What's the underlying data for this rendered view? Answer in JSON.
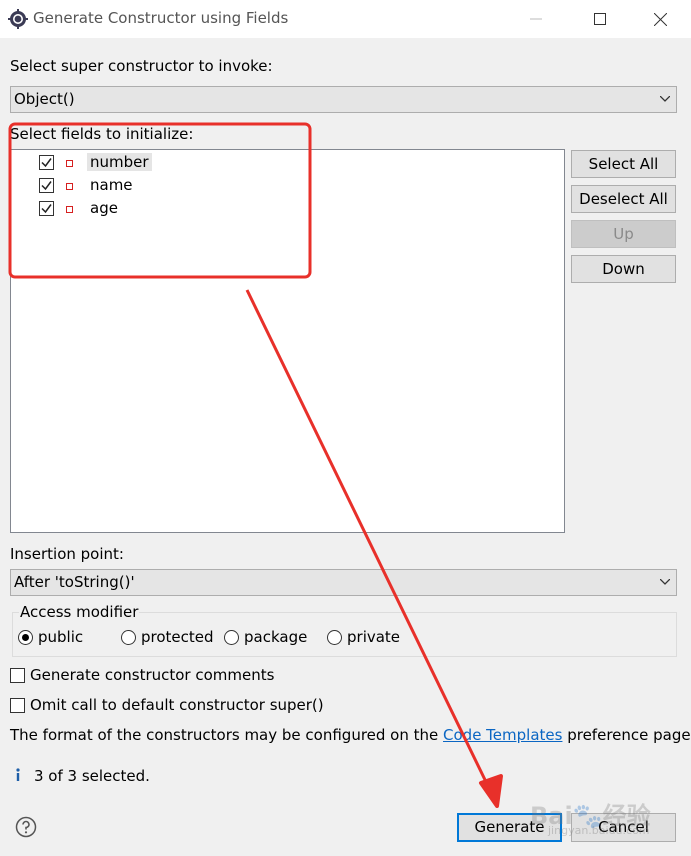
{
  "window": {
    "title": "Generate Constructor using Fields",
    "app_icon": "eclipse-gear-icon",
    "controls": [
      "minimize-icon",
      "maximize-icon",
      "close-icon"
    ]
  },
  "super_constructor": {
    "label": "Select super constructor to invoke:",
    "value": "Object()"
  },
  "fields": {
    "label": "Select fields to initialize:",
    "items": [
      {
        "name": "number",
        "checked": true,
        "selected": true
      },
      {
        "name": "name",
        "checked": true,
        "selected": false
      },
      {
        "name": "age",
        "checked": true,
        "selected": false
      }
    ]
  },
  "side_buttons": {
    "select_all": "Select All",
    "deselect_all": "Deselect All",
    "up": "Up",
    "down": "Down"
  },
  "insertion_point": {
    "label": "Insertion point:",
    "value": "After 'toString()'"
  },
  "access_modifier": {
    "title": "Access modifier",
    "options": [
      "public",
      "protected",
      "package",
      "private"
    ],
    "selected": "public"
  },
  "options": {
    "generate_comments": {
      "label": "Generate constructor comments",
      "checked": false
    },
    "omit_super": {
      "label": "Omit call to default constructor super()",
      "checked": false
    }
  },
  "info": {
    "text_before": "The format of the constructors may be configured on the ",
    "link": "Code Templates",
    "text_after": " preference page."
  },
  "status": {
    "icon": "info-icon",
    "text": "3 of 3 selected."
  },
  "footer": {
    "help_icon": "help-icon",
    "generate": "Generate",
    "cancel": "Cancel"
  },
  "watermark": {
    "brand": "Bai",
    "cjk": "经验",
    "sub": "jingyan.baidu.com"
  },
  "annotation": {
    "color": "#e8302a"
  }
}
